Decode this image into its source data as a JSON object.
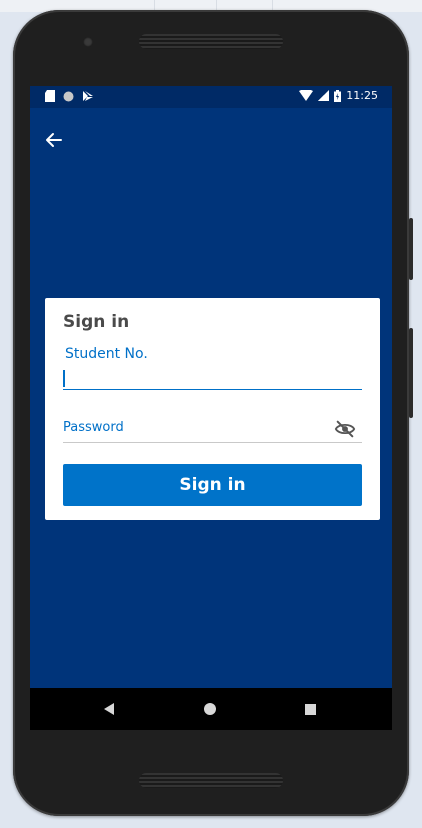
{
  "status_bar": {
    "time": "11:25",
    "left_icons": [
      "sd-card-icon",
      "circle-notification-icon",
      "play-store-icon"
    ],
    "right_icons": [
      "wifi-icon",
      "signal-icon",
      "battery-icon"
    ]
  },
  "header": {
    "back_icon": "arrow-left-icon"
  },
  "signin_card": {
    "title": "Sign in",
    "student_no": {
      "label": "Student No.",
      "value": ""
    },
    "password": {
      "label": "Password",
      "value": "",
      "toggle_icon": "eye-off-icon"
    },
    "submit_label": "Sign in"
  },
  "nav_bar": {
    "icons": [
      "nav-back-icon",
      "nav-home-icon",
      "nav-recents-icon"
    ]
  },
  "colors": {
    "background": "#00347a",
    "status_bar": "#002a66",
    "accent": "#0073c9",
    "card": "#ffffff"
  }
}
